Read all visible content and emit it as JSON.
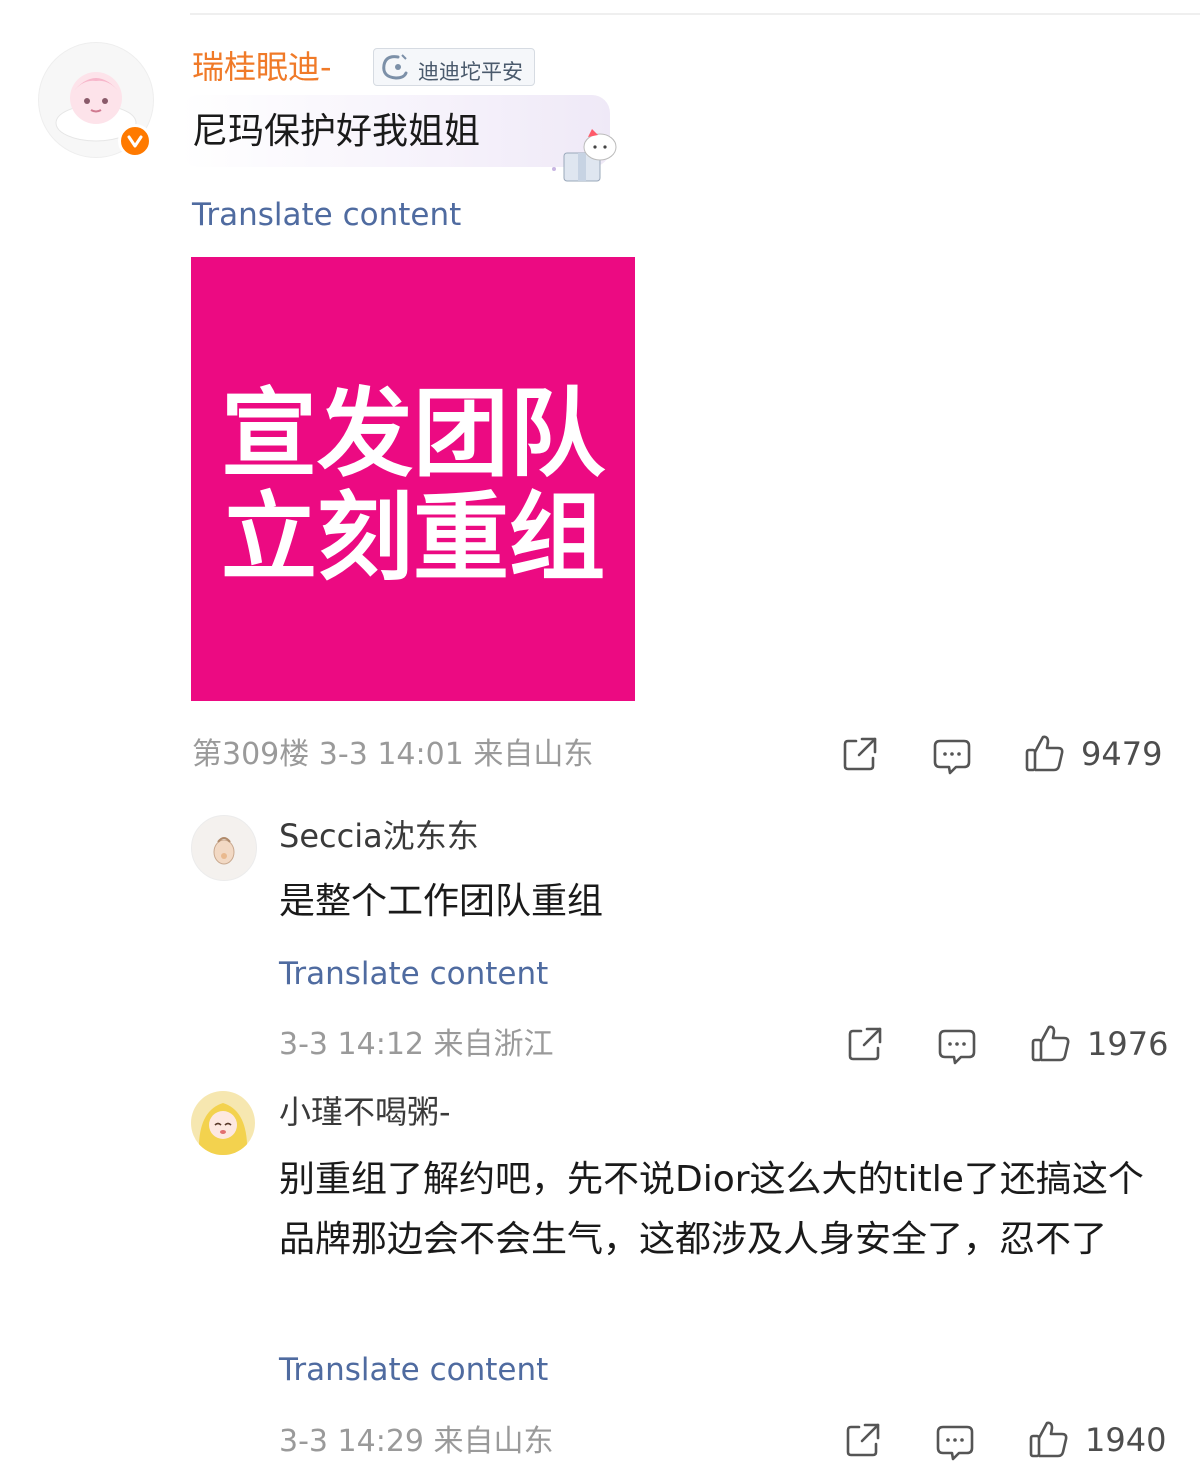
{
  "post": {
    "username": "瑞桂眠迪-",
    "fan_badge": "迪迪坨平安",
    "comment": "尼玛保护好我姐姐",
    "translate_label": "Translate content",
    "image_text": [
      "宣发团队",
      "立刻重组"
    ],
    "meta": "第309楼 3-3 14:01 来自山东",
    "likes": "9479"
  },
  "replies": [
    {
      "username": "Seccia沈东东",
      "comment": "是整个工作团队重组",
      "translate_label": "Translate content",
      "meta": "3-3 14:12 来自浙江",
      "likes": "1976"
    },
    {
      "username": "小瑾不喝粥-",
      "comment": "别重组了解约吧，先不说Dior这么大的title了还搞这个品牌那边会不会生气，这都涉及人身安全了，忍不了",
      "translate_label": "Translate content",
      "meta": "3-3 14:29 来自山东",
      "likes": "1940"
    }
  ],
  "icons": {
    "share": "share-icon",
    "comment": "comment-icon",
    "like": "like-icon",
    "verified": "verified-icon"
  },
  "colors": {
    "username_main": "#f07a28",
    "translate_link": "#4f6ba0",
    "image_bg": "#ec0a82",
    "verified_badge": "#ff7a00"
  }
}
